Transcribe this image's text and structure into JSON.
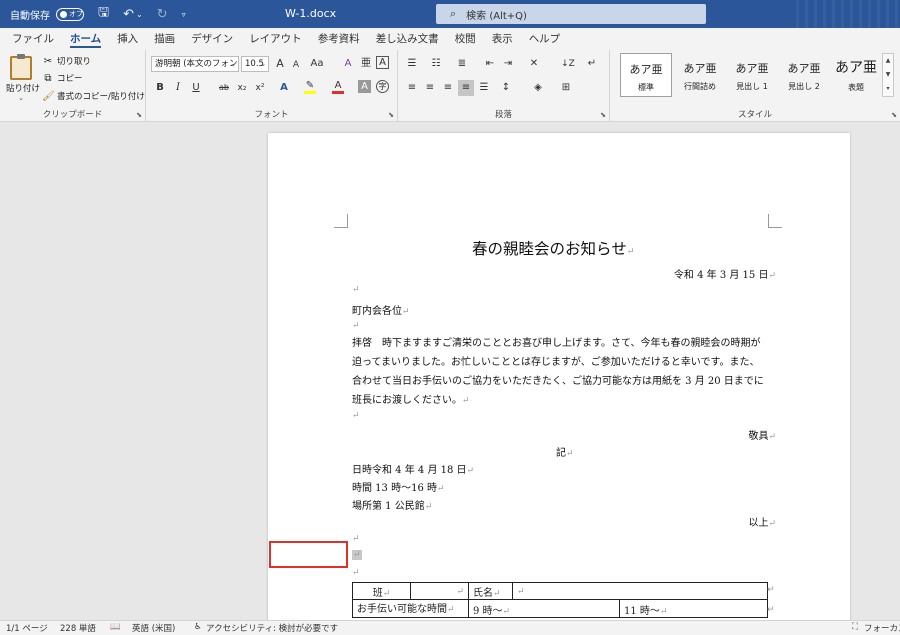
{
  "titlebar": {
    "autosave_label": "自動保存",
    "autosave_state": "オフ",
    "doc_title": "W-1.docx",
    "dropdown_arrow": "⌄",
    "search_placeholder": "検索 (Alt+Q)"
  },
  "tabs": [
    "ファイル",
    "ホーム",
    "挿入",
    "描画",
    "デザイン",
    "レイアウト",
    "参考資料",
    "差し込み文書",
    "校閲",
    "表示",
    "ヘルプ"
  ],
  "ribbon": {
    "clipboard": {
      "paste": "貼り付け",
      "cut": "切り取り",
      "copy": "コピー",
      "format_painter": "書式のコピー/貼り付け",
      "group_label": "クリップボード"
    },
    "font": {
      "font_name": "游明朝 (本文のフォン",
      "font_size": "10.5",
      "change_case": "Aa",
      "group_label": "フォント",
      "colors": {
        "highlight": "#ffff00",
        "font_color": "#e0302a"
      }
    },
    "paragraph": {
      "group_label": "段落"
    },
    "styles": {
      "items": [
        {
          "sample": "あア亜",
          "name": "標準"
        },
        {
          "sample": "あア亜",
          "name": "行間詰め"
        },
        {
          "sample": "あア亜",
          "name": "見出し 1"
        },
        {
          "sample": "あア亜",
          "name": "見出し 2"
        },
        {
          "sample": "あア亜",
          "name": "表題"
        }
      ],
      "group_label": "スタイル"
    }
  },
  "document": {
    "title": "春の親睦会のお知らせ",
    "date": "令和 4 年 3 月 15 日",
    "addressee": "町内会各位",
    "body_lines": [
      "拝啓　時下ますますご清栄のこととお喜び申し上げます。さて、今年も春の親睦会の時期が",
      "迫ってまいりました。お忙しいこととは存じますが、ご参加いただけると幸いです。また、",
      "合わせて当日お手伝いのご協力をいただきたく、ご協力可能な方は用紙を 3 月 20 日までに",
      "班長にお渡しください。"
    ],
    "closing": "敬具",
    "ki": "記",
    "details": [
      "日時令和 4 年 4 月 18 日",
      "時間 13 時～16 時",
      "場所第 1 公民館"
    ],
    "ijo": "以上",
    "table": {
      "row1": [
        "班",
        "",
        "氏名",
        ""
      ],
      "row2": [
        "お手伝い可能な時間",
        "9 時～",
        "11 時～"
      ]
    }
  },
  "statusbar": {
    "page": "1/1 ページ",
    "words": "228 単語",
    "language": "英語 (米国)",
    "accessibility": "アクセシビリティ: 検討が必要です",
    "focus": "フォーカス"
  }
}
